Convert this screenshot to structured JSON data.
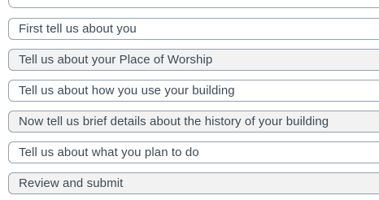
{
  "steps": [
    {
      "label": "First tell us about you"
    },
    {
      "label": "Tell us about your Place of Worship"
    },
    {
      "label": "Tell us about how you use your building"
    },
    {
      "label": "Now tell us brief details about the history of your building"
    },
    {
      "label": "Tell us about what you plan to do"
    },
    {
      "label": "Review and submit"
    }
  ]
}
